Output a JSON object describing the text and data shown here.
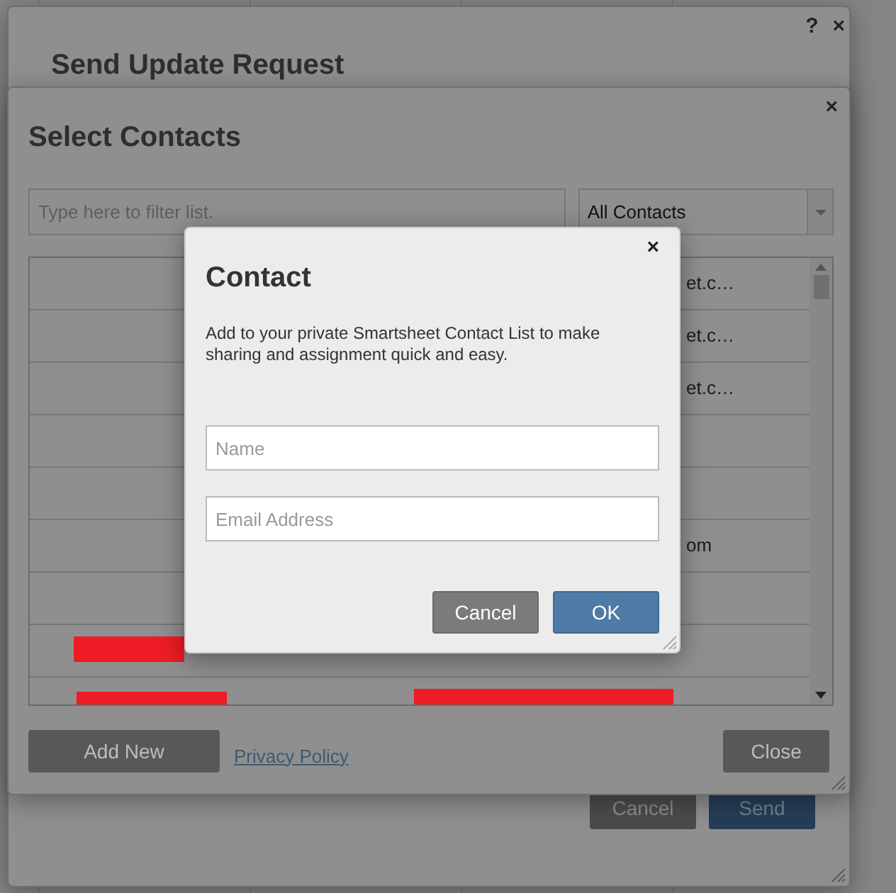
{
  "update_dialog": {
    "title": "Send Update Request",
    "help": "?",
    "close": "×",
    "buttons": [
      {
        "label": "Cancel",
        "kind": "secondary"
      },
      {
        "label": "Send",
        "kind": "primary"
      }
    ]
  },
  "contacts_dialog": {
    "title": "Select Contacts",
    "close": "×",
    "filter": {
      "placeholder": "Type here to filter list."
    },
    "dropdown": {
      "value": "All Contacts"
    },
    "rows": [
      {
        "column_2": "et.c…",
        "redacted_name": false,
        "redacted_email": false
      },
      {
        "column_2": "et.c…",
        "redacted_name": false,
        "redacted_email": false
      },
      {
        "column_2": "et.c…",
        "redacted_name": false,
        "redacted_email": false
      },
      {
        "redacted_name": false,
        "redacted_email": false
      },
      {
        "redacted_name": false,
        "redacted_email": false
      },
      {
        "column_2": "om",
        "redacted_name": false,
        "redacted_email": false
      },
      {
        "redacted_name": false,
        "redacted_email": false
      },
      {
        "redacted_name": true,
        "redacted_email": false
      },
      {
        "redacted_name": true,
        "redacted_email": true
      }
    ],
    "add_button": "Add New",
    "link": "Privacy Policy",
    "close_button": "Close"
  },
  "contact_dialog": {
    "close": "×",
    "title": "Contact",
    "description": "Add to your private Smartsheet Contact List to make sharing and assignment quick and easy.",
    "fields": [
      {
        "placeholder": "Name"
      },
      {
        "placeholder": "Email Address"
      }
    ],
    "buttons": [
      {
        "label": "Cancel",
        "kind": "secondary"
      },
      {
        "label": "OK",
        "kind": "primary"
      }
    ]
  }
}
